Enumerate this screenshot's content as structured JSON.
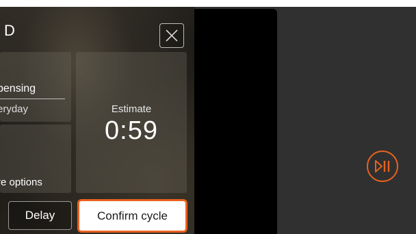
{
  "panel": {
    "title": "D",
    "close_icon": "close-icon",
    "dispensing": {
      "label": "pensing",
      "sub_label": "eryday"
    },
    "options": {
      "label": "re options"
    },
    "estimate": {
      "label": "Estimate",
      "value": "0:59"
    },
    "buttons": {
      "delay": "Delay",
      "confirm": "Confirm cycle"
    }
  },
  "controls": {
    "play_pause_icon": "play-pause-icon"
  },
  "colors": {
    "accent": "#e8621f",
    "device_background": "#303030",
    "panel_black": "#000000"
  }
}
